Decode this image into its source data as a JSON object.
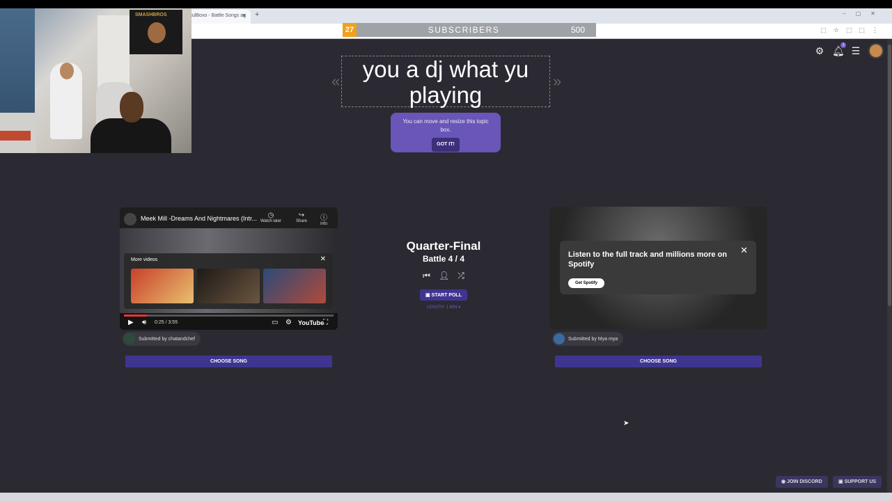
{
  "browser": {
    "tab_title": "tulBoxo - Battle Songs ag",
    "tab_close": "×",
    "new_tab": "+"
  },
  "subscribers": {
    "count": "27",
    "label": "SUBSCRIBERS",
    "goal": "500"
  },
  "header": {
    "notification_count": "3"
  },
  "topic": {
    "text": "you a dj what yu playing",
    "prev_arrow": "«",
    "next_arrow": "»"
  },
  "tooltip": {
    "message": "You can move and resize this topic box.",
    "button": "GOT IT!"
  },
  "left_song": {
    "video_title": "Meek Mill -Dreams And Nightmares (Intr...",
    "watch_later": "Watch later",
    "share": "Share",
    "info": "Info",
    "more_videos": "More videos",
    "time": "0:25 / 3:55",
    "youtube": "YouTube",
    "progress": 0.11,
    "submitted_by": "Submitted by chatandchef",
    "choose_label": "CHOOSE SONG"
  },
  "battle": {
    "round": "Quarter-Final",
    "battle_label": "Battle 4 / 4",
    "start_poll": "START POLL",
    "length": "LENGTH: 1 MIN ▾"
  },
  "right_song": {
    "spotify_text": "Listen to the full track and millions more on Spotify",
    "spotify_button": "Get Spotify",
    "submitted_by": "Submitted by Mya mya",
    "choose_label": "CHOOSE SONG"
  },
  "footer": {
    "discord": "JOIN DISCORD",
    "support": "SUPPORT US"
  },
  "colors": {
    "background": "#2b2a33",
    "accent": "#3f3591",
    "tooltip": "#6a55b8",
    "subscriber_count": "#f0a020"
  }
}
